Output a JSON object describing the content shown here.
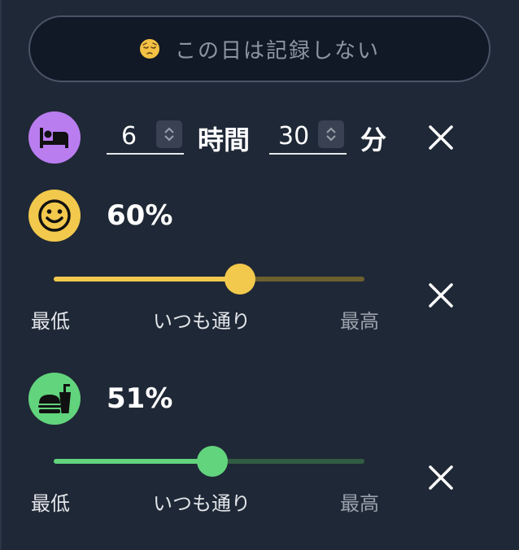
{
  "skip": {
    "label": "この日は記録しない",
    "emoji": "pensive-face"
  },
  "sleep": {
    "icon": "bed-icon",
    "hours_value": "6",
    "hours_unit": "時間",
    "minutes_value": "30",
    "minutes_unit": "分"
  },
  "mood": {
    "icon": "smiley-face-icon",
    "percent_text": "60%",
    "value_fraction": 0.6,
    "scale": {
      "low": "最低",
      "mid": "いつも通り",
      "high": "最高"
    },
    "colors": {
      "fill": "#f2c94c",
      "track": "#6c5f2e"
    }
  },
  "food": {
    "icon": "fast-food-icon",
    "percent_text": "51%",
    "value_fraction": 0.51,
    "scale": {
      "low": "最低",
      "mid": "いつも通り",
      "high": "最高"
    },
    "colors": {
      "fill": "#62d47d",
      "track": "#315c44"
    }
  },
  "colors": {
    "background": "#1f2836",
    "sleep_accent": "#b97df0"
  }
}
